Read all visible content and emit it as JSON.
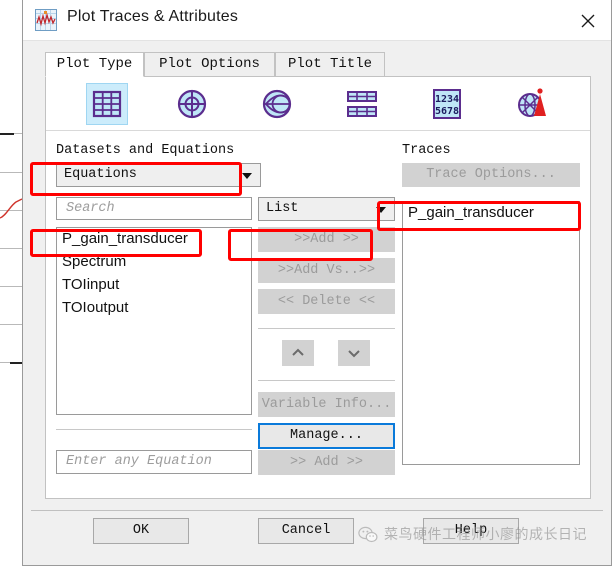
{
  "window": {
    "title": "Plot Traces & Attributes",
    "app_icon": "plot-waveform-icon",
    "close_icon": "close-icon"
  },
  "tabs": [
    {
      "label": "Plot Type",
      "active": true
    },
    {
      "label": "Plot Options",
      "active": false
    },
    {
      "label": "Plot Title",
      "active": false
    }
  ],
  "toolbar": {
    "items": [
      {
        "icon": "rectangular-grid-plot-icon",
        "selected": true
      },
      {
        "icon": "polar-plot-icon",
        "selected": false
      },
      {
        "icon": "smith-chart-icon",
        "selected": false
      },
      {
        "icon": "data-table-plot-icon",
        "selected": false
      },
      {
        "icon": "numeric-table-icon",
        "label": "1234 5678",
        "selected": false
      },
      {
        "icon": "radiation-pattern-antenna-icon",
        "selected": false
      }
    ]
  },
  "left_panel": {
    "section_label": "Datasets and Equations",
    "dataset_combo": {
      "value": "Equations",
      "arrow_icon": "chevron-down-icon"
    },
    "search_input": {
      "placeholder": "Search",
      "value": ""
    },
    "list_combo": {
      "value": "List",
      "arrow_icon": "chevron-down-icon"
    },
    "list_items": [
      {
        "label": "P_gain_transducer",
        "selected": true
      },
      {
        "label": "Spectrum",
        "selected": false
      },
      {
        "label": "TOIinput",
        "selected": false
      },
      {
        "label": "TOIoutput",
        "selected": false
      }
    ],
    "equation_input": {
      "placeholder": "Enter any Equation",
      "value": ""
    }
  },
  "center_buttons": {
    "add": {
      "label": ">>Add >>",
      "enabled": false
    },
    "add_vs": {
      "label": ">>Add Vs..>>",
      "enabled": false
    },
    "delete": {
      "label": "<< Delete <<",
      "enabled": false
    },
    "move_up": {
      "icon": "chevron-up-icon",
      "enabled": false
    },
    "move_down": {
      "icon": "chevron-down-icon",
      "enabled": false
    },
    "variable_info": {
      "label": "Variable Info...",
      "enabled": false
    },
    "manage": {
      "label": "Manage...",
      "enabled": true,
      "focused": true
    },
    "equation_add": {
      "label": ">> Add >>",
      "enabled": false
    }
  },
  "right_panel": {
    "section_label": "Traces",
    "trace_options": {
      "label": "Trace Options...",
      "enabled": false
    },
    "traces": [
      {
        "label": "P_gain_transducer"
      }
    ]
  },
  "footer": {
    "ok": "OK",
    "cancel": "Cancel",
    "help": "Help"
  },
  "watermark": {
    "text": "菜鸟硬件工程师小廖的成长日记",
    "icon": "wechat-logo-icon"
  },
  "annotations": {
    "color": "#ff0000",
    "boxes": [
      "dataset-combo-highlight",
      "list-item-highlight",
      "add-button-highlight",
      "trace-item-highlight"
    ]
  }
}
